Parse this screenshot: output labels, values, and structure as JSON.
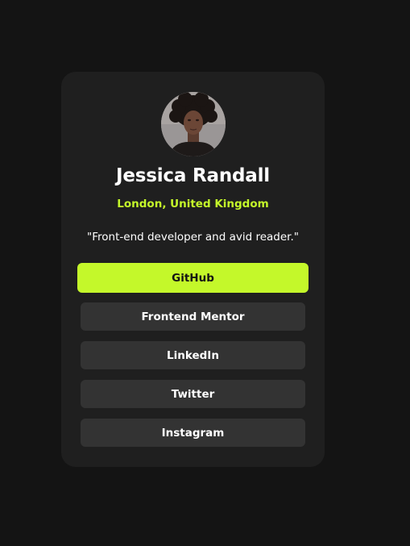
{
  "profile": {
    "name": "Jessica Randall",
    "location": "London, United Kingdom",
    "bio": "\"Front-end developer and avid reader.\""
  },
  "links": [
    {
      "label": "GitHub",
      "active": true
    },
    {
      "label": "Frontend Mentor",
      "active": false
    },
    {
      "label": "LinkedIn",
      "active": false
    },
    {
      "label": "Twitter",
      "active": false
    },
    {
      "label": "Instagram",
      "active": false
    }
  ],
  "colors": {
    "background": "#141414",
    "card": "#1f1f1f",
    "button": "#333333",
    "accent": "#c4f82a",
    "text": "#ffffff"
  }
}
